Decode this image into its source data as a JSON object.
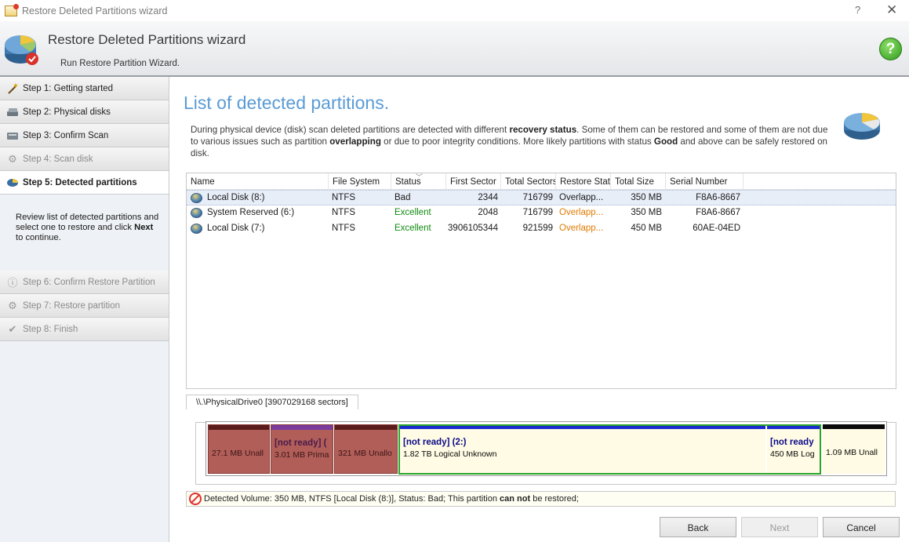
{
  "window": {
    "title": "Restore Deleted Partitions wizard",
    "help_glyph": "?",
    "close_glyph": "✕"
  },
  "header": {
    "title": "Restore Deleted Partitions wizard",
    "subtitle": "Run Restore Partition Wizard.",
    "help_glyph": "?"
  },
  "sidebar": {
    "steps": [
      {
        "label": "Step 1: Getting started",
        "icon": "wand-icon",
        "state": "normal"
      },
      {
        "label": "Step 2: Physical disks",
        "icon": "disks-icon",
        "state": "normal"
      },
      {
        "label": "Step 3: Confirm Scan",
        "icon": "confirm-icon",
        "state": "normal"
      },
      {
        "label": "Step 4: Scan disk",
        "icon": "scan-gear-icon",
        "state": "disabled"
      },
      {
        "label": "Step 5: Detected partitions",
        "icon": "disk-icon",
        "state": "active"
      },
      {
        "label": "Step 6: Confirm Restore Partition",
        "icon": "info-icon",
        "state": "disabled"
      },
      {
        "label": "Step 7: Restore partition",
        "icon": "gear-icon",
        "state": "disabled"
      },
      {
        "label": "Step 8: Finish",
        "icon": "check-icon",
        "state": "disabled"
      }
    ],
    "desc_pre": "Review list of detected partitions and select one to restore and click ",
    "desc_bold": "Next",
    "desc_post": " to continue."
  },
  "main": {
    "title": "List of detected partitions.",
    "desc": {
      "p1": "During physical device (disk) scan deleted partitions are detected with different ",
      "b1": "recovery status",
      "p2": ". Some of them can be restored and some of them are not due to various issues such as partition ",
      "b2": "overlapping",
      "p3": " or due to poor integrity conditions. More likely partitions with status ",
      "b3": "Good",
      "p4": " and above can be safely restored on disk."
    }
  },
  "table": {
    "columns": [
      "Name",
      "File System",
      "Status",
      "First Sector",
      "Total Sectors",
      "Restore Stat",
      "Total Size",
      "Serial Number"
    ],
    "sort_glyph": "﹀",
    "rows": [
      {
        "name": "Local Disk (8:)",
        "fs": "NTFS",
        "status": "Bad",
        "first": "2344",
        "total": "716799",
        "restore": "Overlapp...",
        "size": "350 MB",
        "serial": "F8A6-8667"
      },
      {
        "name": "System Reserved (6:)",
        "fs": "NTFS",
        "status": "Excellent",
        "first": "2048",
        "total": "716799",
        "restore": "Overlapp...",
        "size": "350 MB",
        "serial": "F8A6-8667"
      },
      {
        "name": "Local Disk (7:)",
        "fs": "NTFS",
        "status": "Excellent",
        "first": "3906105344",
        "total": "921599",
        "restore": "Overlapp...",
        "size": "450 MB",
        "serial": "60AE-04ED"
      }
    ]
  },
  "drive": {
    "tab_label": "\\\\.\\PhysicalDrive0 [3907029168 sectors]",
    "segments": [
      {
        "title": "",
        "text": "27.1 MB Unall"
      },
      {
        "title": "[not ready] (",
        "text": "3.01 MB Prima"
      },
      {
        "title": "",
        "text": "321 MB Unallo"
      },
      {
        "title": "[not ready] (2:)",
        "text": "1.82 TB Logical Unknown"
      },
      {
        "title": "[not ready",
        "text": "450 MB Log"
      },
      {
        "title": "",
        "text": "1.09 MB Unall"
      }
    ]
  },
  "status_line": {
    "pre": "Detected Volume: 350 MB, NTFS [Local Disk (8:)], Status: Bad; This partition ",
    "bold": "can not",
    "post": " be restored;"
  },
  "buttons": {
    "back": "Back",
    "next": "Next",
    "cancel": "Cancel"
  }
}
